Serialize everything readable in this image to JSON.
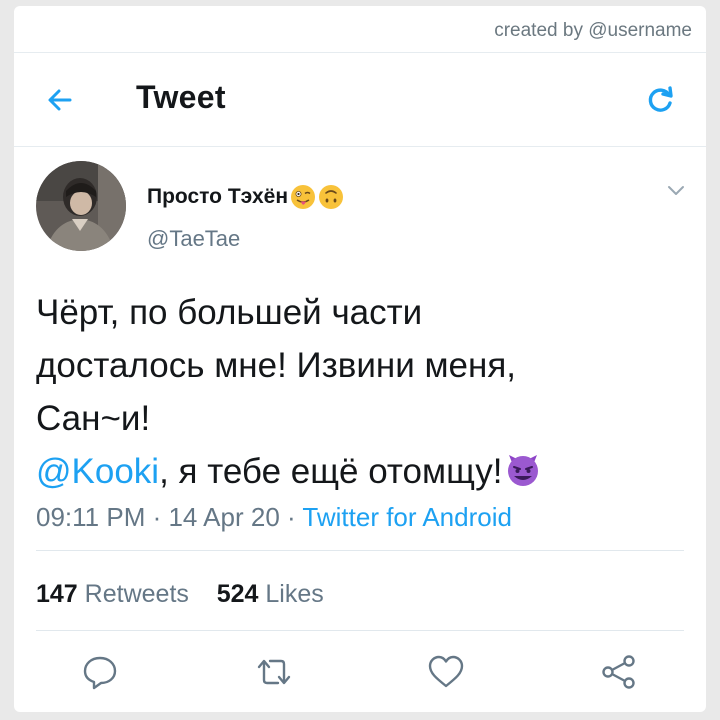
{
  "credit": "created by @username",
  "header": {
    "title": "Tweet"
  },
  "tweet": {
    "display_name": "Просто Тэхён",
    "display_name_emojis": [
      "winking-tongue-emoji",
      "upside-down-face-emoji"
    ],
    "handle": "@TaeTae",
    "text_line1": "Чёрт, по большей части",
    "text_line2": "досталось мне! Извини меня,",
    "text_line3": "Сан~и!",
    "mention": "@Kooki",
    "text_after_mention": ", я тебе ещё отомщу!",
    "trailing_emoji": "smiling-devil-emoji",
    "time": "09:11 PM",
    "sep": " · ",
    "date": "14 Apr 20",
    "client": "Twitter for Android"
  },
  "stats": {
    "retweets_count": "147",
    "retweets_label": "Retweets",
    "likes_count": "524",
    "likes_label": "Likes"
  },
  "colors": {
    "accent": "#1da1f2",
    "text": "#14171a",
    "secondary": "#657786"
  },
  "icons": [
    "back-arrow-icon",
    "refresh-icon",
    "chevron-down-icon",
    "reply-icon",
    "retweet-icon",
    "like-icon",
    "share-icon"
  ]
}
